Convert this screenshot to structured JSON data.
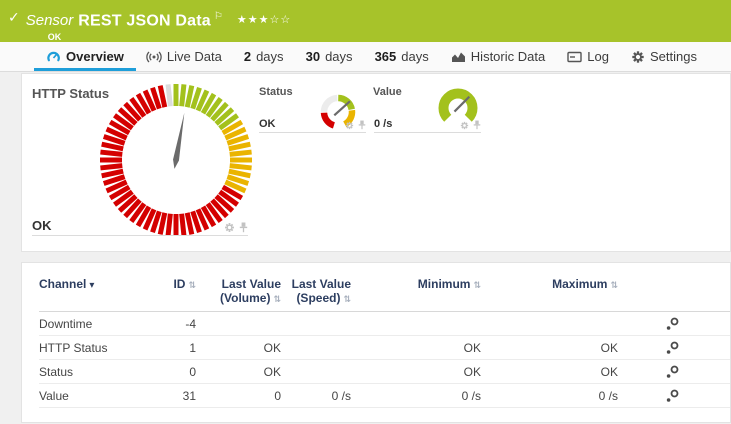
{
  "header": {
    "kind_label": "Sensor",
    "title": "REST JSON Data",
    "status_text": "OK",
    "stars_filled": "★★★",
    "stars_empty": "☆☆",
    "check_glyph": "✓",
    "flag_glyph": "⚐"
  },
  "tabs": [
    {
      "label": "Overview",
      "icon": "gauge-icon",
      "active": true
    },
    {
      "label": "Live Data",
      "icon": "broadcast-icon"
    },
    {
      "prefix": "2",
      "label": "days"
    },
    {
      "prefix": "30",
      "label": "days"
    },
    {
      "prefix": "365",
      "label": "days"
    },
    {
      "label": "Historic Data",
      "icon": "chart-icon"
    },
    {
      "label": "Log",
      "icon": "log-icon"
    },
    {
      "label": "Settings",
      "icon": "gear-icon"
    }
  ],
  "colors": {
    "brand_green": "#a7c32a",
    "accent_blue": "#1e9ed9",
    "gauge_green": "#a3c11c",
    "gauge_yellow": "#eab400",
    "gauge_red": "#d40000",
    "gauge_neutral": "#dcdcdc",
    "needle": "#6b6b6b",
    "header_navy": "#2d3e60"
  },
  "chart_data": [
    {
      "type": "gauge",
      "style": "ticks",
      "title": "HTTP Status",
      "value": "OK",
      "tick_step": 6,
      "needle_deg": 10,
      "zones": [
        {
          "start": 0,
          "end": 54,
          "color": "#a3c11c",
          "meaning": "ok"
        },
        {
          "start": 60,
          "end": 114,
          "color": "#eab400",
          "meaning": "warning"
        },
        {
          "start": 120,
          "end": 348,
          "color": "#d40000",
          "meaning": "error"
        },
        {
          "start": 354,
          "end": 354,
          "color": "#dcdcdc",
          "meaning": "start-marker"
        }
      ]
    },
    {
      "type": "gauge",
      "style": "arc",
      "title": "Status",
      "value": "OK",
      "needle_deg": 48,
      "segments": [
        {
          "start": -89,
          "end": -3,
          "color": "#ececec",
          "meaning": "none"
        },
        {
          "start": 1,
          "end": 79,
          "color": "#a3c11c",
          "meaning": "ok"
        },
        {
          "start": 83,
          "end": 151,
          "color": "#eab400",
          "meaning": "warning"
        },
        {
          "start": 197,
          "end": 267,
          "color": "#d40000",
          "meaning": "error"
        }
      ]
    },
    {
      "type": "gauge",
      "style": "arc",
      "title": "Value",
      "value": "0 /s",
      "needle_deg": 45,
      "segments": [
        {
          "start": -135,
          "end": 135,
          "color": "#a3c11c",
          "meaning": "scale"
        }
      ]
    }
  ],
  "table": {
    "columns": [
      "Channel",
      "ID",
      "Last Value (Volume)",
      "Last Value (Speed)",
      "Minimum",
      "Maximum"
    ],
    "sort_desc_glyph": "▾",
    "sort_both_glyph": "⇅",
    "rows": [
      {
        "channel": "Downtime",
        "id": "-4",
        "volume": "",
        "speed": "",
        "min": "",
        "max": ""
      },
      {
        "channel": "HTTP Status",
        "id": "1",
        "volume": "OK",
        "speed": "",
        "min": "OK",
        "max": "OK"
      },
      {
        "channel": "Status",
        "id": "0",
        "volume": "OK",
        "speed": "",
        "min": "OK",
        "max": "OK"
      },
      {
        "channel": "Value",
        "id": "31",
        "volume": "0",
        "speed": "0 /s",
        "min": "0 /s",
        "max": "0 /s"
      }
    ]
  }
}
